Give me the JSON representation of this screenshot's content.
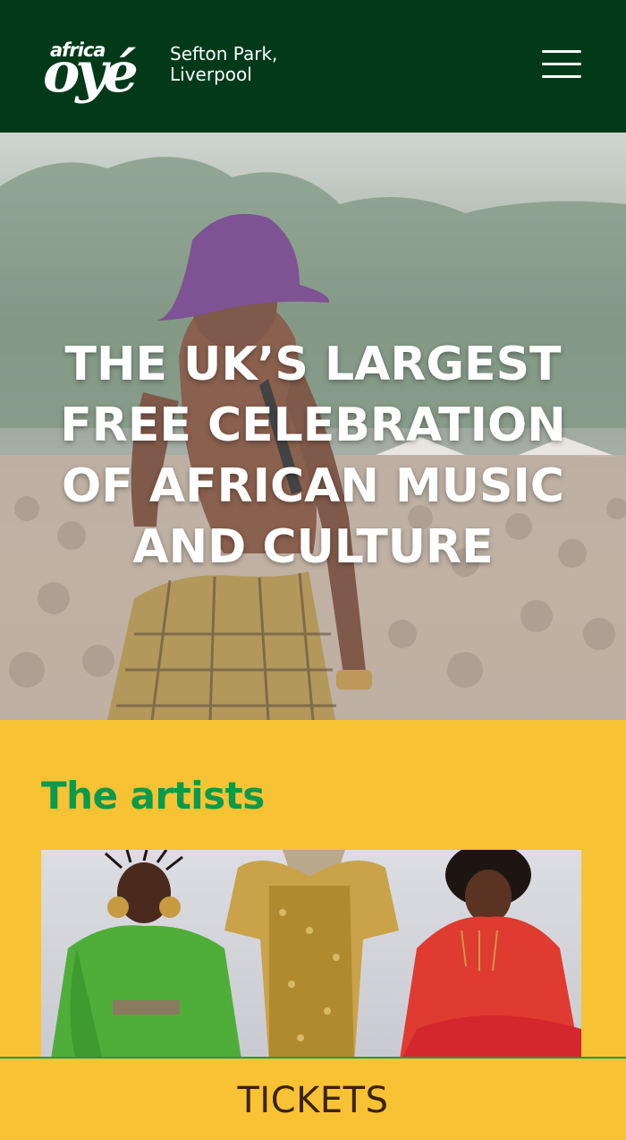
{
  "header": {
    "logo_small": "africa",
    "logo_big": "oyé",
    "location": "Sefton Park,\nLiverpool",
    "menu_icon": "hamburger-menu-icon",
    "background_color": "#023a19"
  },
  "hero": {
    "headline": "THE UK’S LARGEST FREE CELEBRATION OF AFRICAN MUSIC AND CULTURE"
  },
  "artists": {
    "title": "The artists",
    "title_color": "#0a9a4c",
    "background_color": "#f8c235"
  },
  "cta": {
    "tickets_label": "TICKETS"
  }
}
